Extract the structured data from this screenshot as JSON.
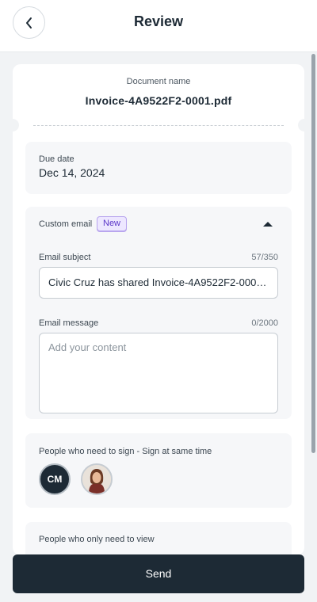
{
  "header": {
    "title": "Review",
    "back_icon": "chevron-left-icon"
  },
  "document": {
    "label": "Document name",
    "name": "Invoice-4A9522F2-0001.pdf"
  },
  "due_date": {
    "label": "Due date",
    "value": "Dec 14, 2024"
  },
  "custom_email": {
    "label": "Custom email",
    "badge": "New",
    "toggle_icon": "caret-up-icon",
    "subject": {
      "label": "Email subject",
      "count": "57/350",
      "value": "Civic Cruz has shared Invoice-4A9522F2-0001.pdf"
    },
    "message": {
      "label": "Email message",
      "count": "0/2000",
      "placeholder": "Add your content"
    }
  },
  "signers": {
    "label": "People who need to sign - Sign at same time",
    "people": [
      {
        "initials": "CM"
      },
      {
        "avatar": "person-photo"
      }
    ]
  },
  "viewers": {
    "label": "People who only need to view"
  },
  "footer": {
    "send_label": "Send"
  },
  "colors": {
    "primary": "#1d2a35",
    "badge_bg": "#ede7ff",
    "badge_text": "#5a35c8"
  }
}
